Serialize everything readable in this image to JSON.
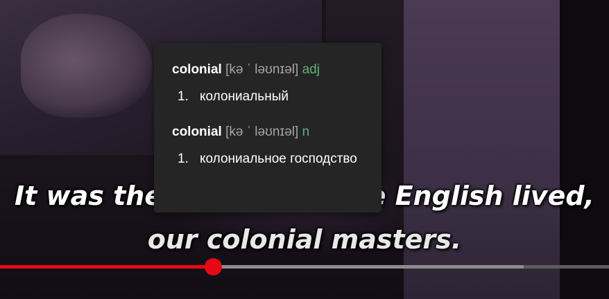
{
  "subtitles": {
    "line1": "It was the time when the English lived,",
    "line2": "our colonial masters."
  },
  "dictionary": {
    "entries": [
      {
        "word": "colonial",
        "transcription": "[kə ˈ ləʊnɪəl]",
        "part_of_speech": "adj",
        "senses": [
          {
            "num": "1.",
            "text": "колониальный"
          }
        ]
      },
      {
        "word": "colonial",
        "transcription": "[kə ˈ ləʊnɪəl]",
        "part_of_speech": "n",
        "senses": [
          {
            "num": "1.",
            "text": "колониальное господство"
          }
        ]
      }
    ]
  },
  "player": {
    "progress_fraction": 0.35,
    "buffered_fraction": 0.86
  },
  "colors": {
    "popup_bg": "#252525",
    "part_of_speech": "#5cb37a",
    "progress_played": "#e50914",
    "subtitle": "#ffffff"
  }
}
